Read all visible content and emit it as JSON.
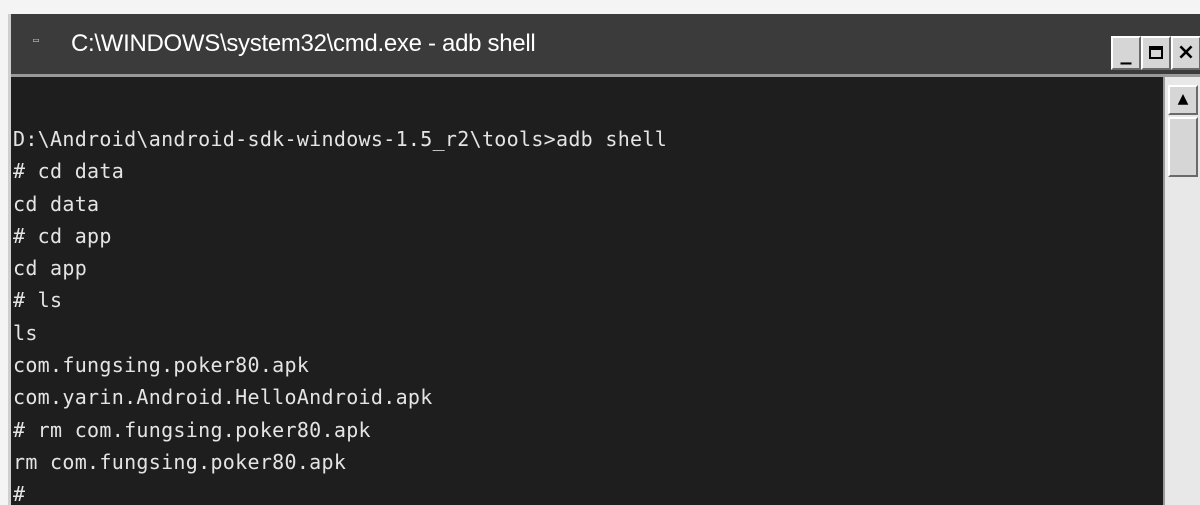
{
  "window": {
    "title": "C:\\WINDOWS\\system32\\cmd.exe - adb shell",
    "icon": "console-icon",
    "controls": {
      "minimize_label": "_",
      "maximize_icon": "maximize-icon",
      "close_label": "×"
    }
  },
  "console": {
    "lines": [
      "D:\\Android\\android-sdk-windows-1.5_r2\\tools>adb shell",
      "# cd data",
      "cd data",
      "# cd app",
      "cd app",
      "# ls",
      "ls",
      "com.fungsing.poker80.apk",
      "com.yarin.Android.HelloAndroid.apk",
      "# rm com.fungsing.poker80.apk",
      "rm com.fungsing.poker80.apk",
      "#"
    ]
  },
  "scrollbar": {
    "up_arrow_icon": "scroll-up-arrow-icon"
  },
  "colors": {
    "console_background": "#1e1e1e",
    "console_text": "#e4e4e4",
    "titlebar_background": "#3b3b3b"
  }
}
